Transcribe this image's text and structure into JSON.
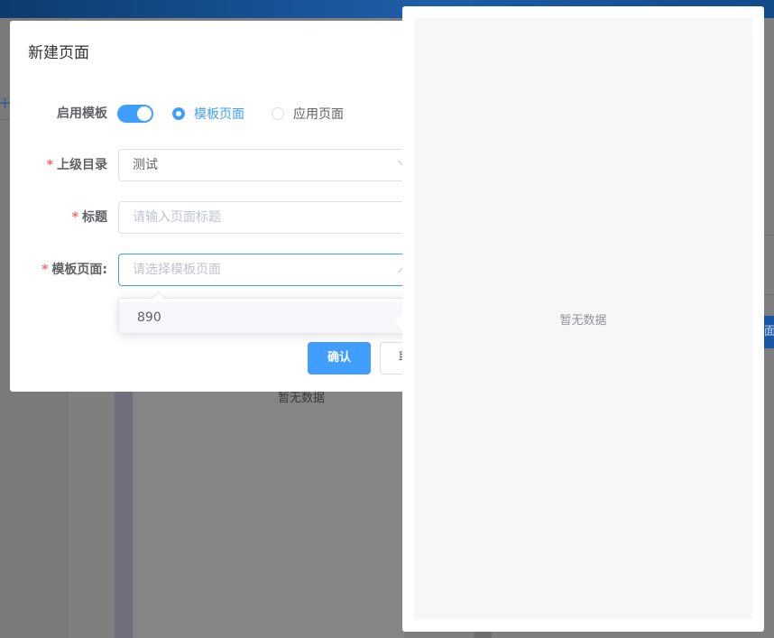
{
  "background": {
    "empty_text": "暂无数据",
    "right_button_text": "面"
  },
  "modal": {
    "title": "新建页面",
    "enable_template": {
      "label": "启用模板",
      "on": true,
      "options": [
        {
          "label": "模板页面",
          "checked": true
        },
        {
          "label": "应用页面",
          "checked": false
        }
      ]
    },
    "parent_dir": {
      "required": "*",
      "label": "上级目录",
      "value": "测试"
    },
    "title_field": {
      "required": "*",
      "label": "标题",
      "placeholder": "请输入页面标题"
    },
    "template_page": {
      "required": "*",
      "label": "模板页面:",
      "placeholder": "请选择模板页面"
    },
    "dropdown_options": [
      "890"
    ],
    "confirm_label": "确认",
    "cancel_label": "取消"
  },
  "drawer": {
    "empty_text": "暂无数据"
  },
  "colors": {
    "primary": "#409eff",
    "required": "#f56c6c",
    "overlay": "#808080"
  }
}
